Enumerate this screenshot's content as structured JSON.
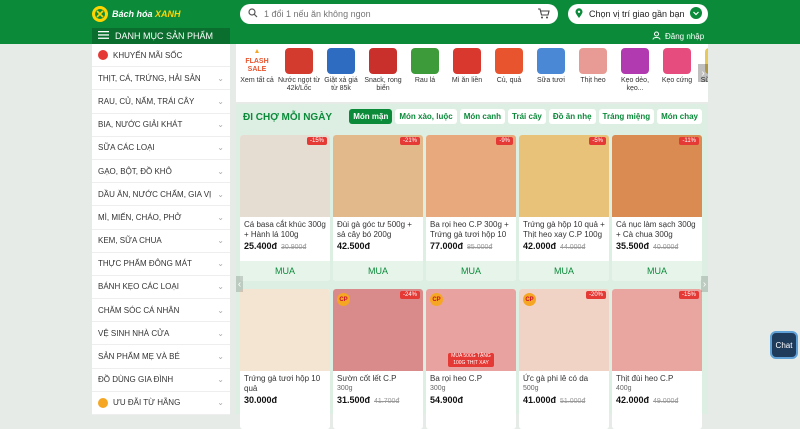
{
  "brand": {
    "name_part1": "Bách hóa ",
    "name_part2": "XANH"
  },
  "search": {
    "placeholder": "1 đổi 1 nếu ăn không ngon"
  },
  "location": {
    "label": "Chọn vị trí giao gần bạn"
  },
  "categories_button": {
    "label": "DANH MỤC SẢN PHẨM"
  },
  "login": {
    "label": "Đăng nhập"
  },
  "sidebar": {
    "items": [
      {
        "label": "KHUYẾN MÃI SỐC"
      },
      {
        "label": "THỊT, CÁ, TRỨNG, HẢI SẢN"
      },
      {
        "label": "RAU, CỦ, NẤM, TRÁI CÂY"
      },
      {
        "label": "BIA, NƯỚC GIẢI KHÁT"
      },
      {
        "label": "SỮA CÁC LOẠI"
      },
      {
        "label": "GẠO, BỘT, ĐỒ KHÔ"
      },
      {
        "label": "DẦU ĂN, NƯỚC CHẤM, GIA VỊ"
      },
      {
        "label": "MÌ, MIẾN, CHÁO, PHỞ"
      },
      {
        "label": "KEM, SỮA CHUA"
      },
      {
        "label": "THỰC PHẨM ĐÔNG MÁT"
      },
      {
        "label": "BÁNH KẸO CÁC LOẠI"
      },
      {
        "label": "CHĂM SÓC CÁ NHÂN"
      },
      {
        "label": "VỆ SINH NHÀ CỬA"
      },
      {
        "label": "SẢN PHẨM MẸ VÀ BÉ"
      },
      {
        "label": "ĐỒ DÙNG GIA ĐÌNH"
      },
      {
        "label": "ƯU ĐÃI TỪ HÃNG"
      }
    ]
  },
  "category_strip": [
    {
      "label": "Xem tất cả",
      "color": "#fff3d6"
    },
    {
      "label": "Nước ngọt từ 42k/Lốc",
      "color": "#d33b2f"
    },
    {
      "label": "Giặt xả giá từ 85k",
      "color": "#2d6cc0"
    },
    {
      "label": "Snack, rong biển",
      "color": "#c9302c"
    },
    {
      "label": "Rau lá",
      "color": "#3e9b3a"
    },
    {
      "label": "Mì ăn liền",
      "color": "#d8382e"
    },
    {
      "label": "Củ, quả",
      "color": "#e8542e"
    },
    {
      "label": "Sữa tươi",
      "color": "#4a88d6"
    },
    {
      "label": "Thịt heo",
      "color": "#e79b94"
    },
    {
      "label": "Kẹo dẻo, kẹo...",
      "color": "#b23ab0"
    },
    {
      "label": "Kẹo cứng",
      "color": "#e64c7d"
    },
    {
      "label": "Sữa uống...",
      "color": "#e7c95b"
    }
  ],
  "market": {
    "title": "ĐI CHỢ MỖI NGÀY",
    "tabs": [
      "Món mặn",
      "Món xào, luộc",
      "Món canh",
      "Trái cây",
      "Đồ ăn nhẹ",
      "Tráng miệng",
      "Món chay"
    ],
    "products_row1": [
      {
        "name": "Cá basa cắt khúc 300g + Hành lá 100g",
        "price": "25.400đ",
        "old": "30.900đ",
        "discount": "-15%",
        "color": "#e6ddd2",
        "buy": "MUA"
      },
      {
        "name": "Đùi gà góc tư 500g + sả cây bó 200g",
        "price": "42.500đ",
        "old": "",
        "discount": "-21%",
        "color": "#e2b98a",
        "buy": "MUA"
      },
      {
        "name": "Ba rọi heo C.P 300g + Trứng gà tươi hộp 10 quả",
        "price": "77.000đ",
        "old": "85.000đ",
        "discount": "-9%",
        "color": "#e8a97c",
        "buy": "MUA"
      },
      {
        "name": "Trứng gà hộp 10 quả + Thịt heo xay C.P 100g",
        "price": "42.000đ",
        "old": "44.000đ",
        "discount": "-5%",
        "color": "#e9c27a",
        "buy": "MUA"
      },
      {
        "name": "Cá nục làm sạch 300g + Cà chua 300g",
        "price": "35.500đ",
        "old": "40.000đ",
        "discount": "-11%",
        "color": "#d98b52",
        "buy": "MUA"
      }
    ],
    "products_row2": [
      {
        "name": "Trứng gà tươi hộp 10 quả",
        "weight": "",
        "price": "30.000đ",
        "old": "",
        "discount": "",
        "badge": "",
        "color": "#f4e5d2"
      },
      {
        "name": "Sườn cốt lết C.P",
        "weight": "300g",
        "price": "31.500đ",
        "old": "41.700đ",
        "discount": "-24%",
        "badge": "CP",
        "color": "#d98a8a"
      },
      {
        "name": "Ba rọi heo C.P",
        "weight": "300g",
        "price": "54.900đ",
        "old": "",
        "discount": "",
        "badge": "CP",
        "color": "#e8a3a0"
      },
      {
        "name": "Ức gà phi lê có da",
        "weight": "500g",
        "price": "41.000đ",
        "old": "51.000đ",
        "discount": "-20%",
        "badge": "CP",
        "color": "#f1d3c6"
      },
      {
        "name": "Thịt đùi heo C.P",
        "weight": "400g",
        "price": "42.000đ",
        "old": "49.000đ",
        "discount": "-15%",
        "badge": "",
        "color": "#e9a6a0"
      }
    ],
    "promo_strip_text": "MUA 500G TẶNG 100G THỊT XAY",
    "cp_badge": "CP"
  },
  "chat": {
    "label": "Chat"
  },
  "colors": {
    "brand_green": "#0b8a3a",
    "accent_yellow": "#ffd400",
    "discount_red": "#e53935"
  }
}
